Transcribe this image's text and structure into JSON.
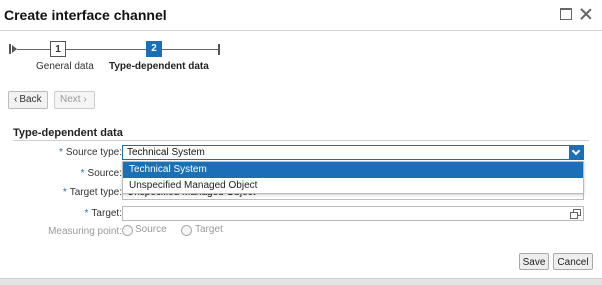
{
  "window": {
    "title": "Create interface channel",
    "maximize_icon": "maximize-icon",
    "close_icon": "close-icon"
  },
  "wizard": {
    "steps": [
      {
        "number": "1",
        "label": "General data",
        "active": false
      },
      {
        "number": "2",
        "label": "Type-dependent data",
        "active": true
      }
    ],
    "active_color": "#1a6fb5"
  },
  "navigation": {
    "back_label": "Back",
    "next_label": "Next",
    "back_icon": "chevron-left-icon",
    "next_icon": "chevron-right-icon"
  },
  "section": {
    "title": "Type-dependent data"
  },
  "form": {
    "required_marker": "*",
    "source_type": {
      "label": "Source type:",
      "value": "Technical System",
      "dropdown_open": true,
      "options": [
        "Technical System",
        "Unspecified Managed Object"
      ],
      "selected_index": 0
    },
    "source": {
      "label": "Source:",
      "value": ""
    },
    "target_type": {
      "label": "Target type:",
      "value": "Unspecified Managed Object"
    },
    "target": {
      "label": "Target:",
      "value": "",
      "value_help_icon": "value-help-icon"
    },
    "measuring_point": {
      "label": "Measuring point:",
      "options": [
        "Source",
        "Target"
      ],
      "disabled": true
    }
  },
  "footer": {
    "save_label": "Save",
    "cancel_label": "Cancel"
  }
}
